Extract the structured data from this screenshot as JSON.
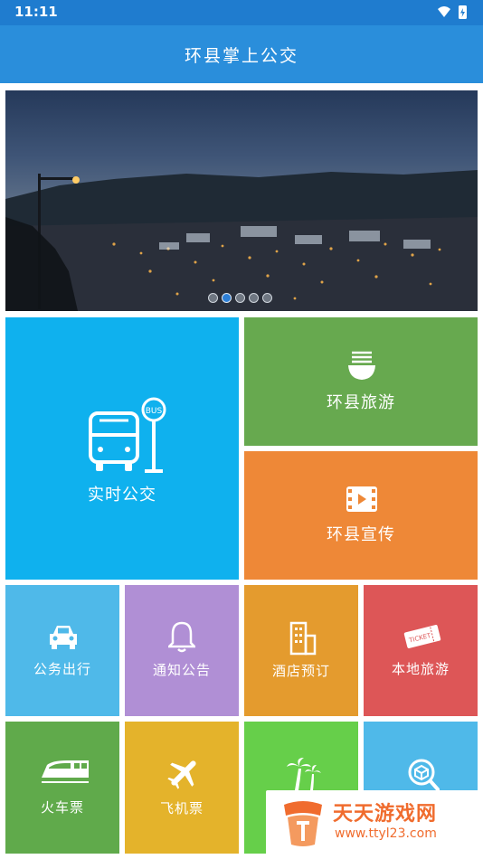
{
  "status_bar": {
    "time": "11:11",
    "icons": [
      "wifi-icon",
      "battery-charging-icon"
    ]
  },
  "app_bar": {
    "title": "环县掌上公交"
  },
  "banner": {
    "slide_count": 5,
    "active_slide": 2
  },
  "tiles": {
    "realtime_bus": {
      "label": "实时公交",
      "icon": "bus-stop-icon",
      "color": "#0fb1ee"
    },
    "tourism": {
      "label": "环县旅游",
      "icon": "noodle-bowl-icon",
      "color": "#67a94f"
    },
    "promo": {
      "label": "环县宣传",
      "icon": "film-play-icon",
      "color": "#ee8837"
    },
    "official_trip": {
      "label": "公务出行",
      "icon": "car-icon",
      "color": "#4fb9e9"
    },
    "notice": {
      "label": "通知公告",
      "icon": "bell-icon",
      "color": "#b08fd5"
    },
    "hotel": {
      "label": "酒店预订",
      "icon": "building-icon",
      "color": "#e49b2e"
    },
    "local_tour": {
      "label": "本地旅游",
      "icon": "ticket-icon",
      "color": "#dd5657"
    },
    "train": {
      "label": "火车票",
      "icon": "train-icon",
      "color": "#60aa4b"
    },
    "flight": {
      "label": "飞机票",
      "icon": "airplane-icon",
      "color": "#e4b32b"
    },
    "scenic": {
      "label": "",
      "icon": "palm-tree-icon",
      "color": "#66cf4a"
    },
    "search": {
      "label": "",
      "icon": "search-box-icon",
      "color": "#4fb9e9"
    }
  },
  "ticket_text": "TICKET",
  "bus_sign_text": "BUS",
  "watermark": {
    "name": "天天游戏网",
    "url": "www.ttyl23.com"
  }
}
